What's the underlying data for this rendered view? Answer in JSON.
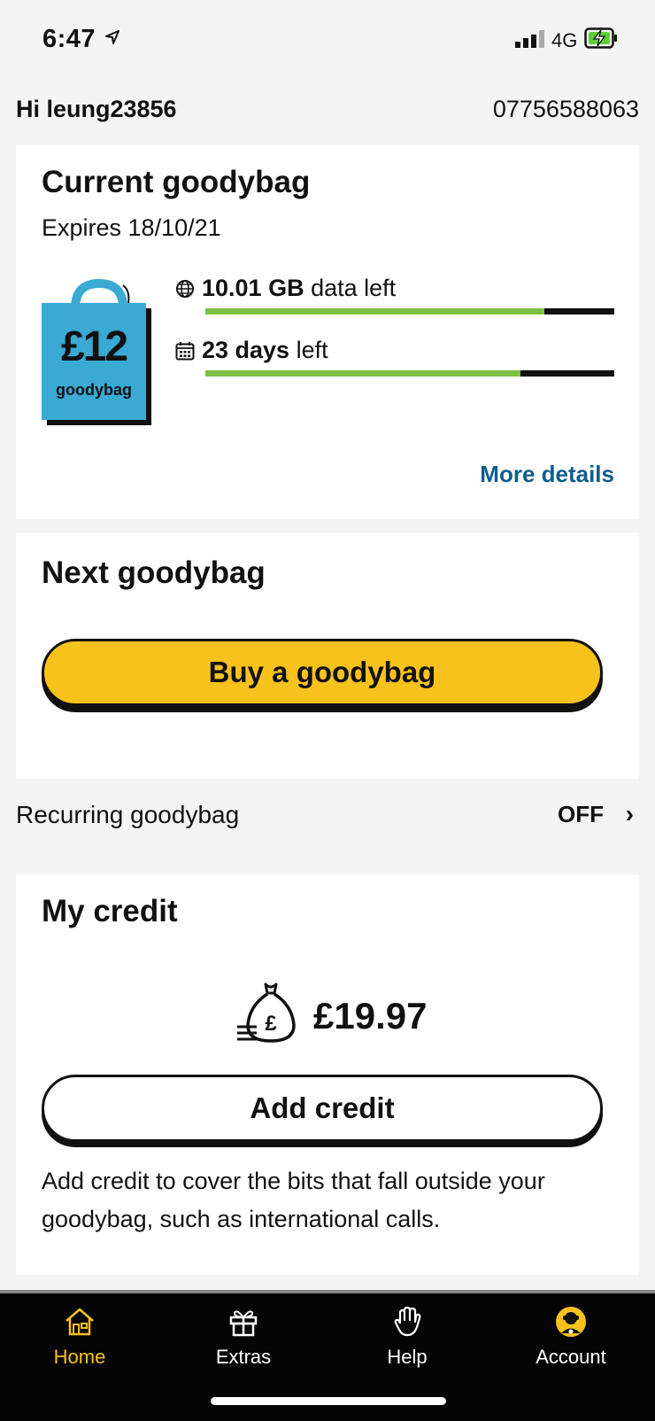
{
  "status_bar": {
    "time": "6:47",
    "network": "4G"
  },
  "header": {
    "greeting": "Hi leung23856",
    "phone_number": "07756588063"
  },
  "current_goodybag": {
    "title": "Current goodybag",
    "expires": "Expires 18/10/21",
    "bag_price": "£12",
    "bag_label": "goodybag",
    "data_value": "10.01 GB",
    "data_suffix": "data left",
    "data_progress_fraction": 0.83,
    "days_value": "23 days",
    "days_suffix": "left",
    "days_progress_fraction": 0.77,
    "more_details": "More details",
    "colors": {
      "bag": "#3aa9d3",
      "progress": "#7bc143",
      "link": "#0d5d8f"
    }
  },
  "next_goodybag": {
    "title": "Next goodybag",
    "buy_button": "Buy a goodybag",
    "button_color": "#f8c21c"
  },
  "recurring": {
    "label": "Recurring goodybag",
    "value": "OFF"
  },
  "credit": {
    "title": "My credit",
    "amount": "£19.97",
    "add_button": "Add credit",
    "description": "Add credit to cover the bits that fall outside your goodybag, such as international calls."
  },
  "tabs": [
    {
      "label": "Home",
      "icon": "home-icon",
      "active": true
    },
    {
      "label": "Extras",
      "icon": "gift-icon",
      "active": false
    },
    {
      "label": "Help",
      "icon": "hand-icon",
      "active": false
    },
    {
      "label": "Account",
      "icon": "avatar-icon",
      "active": false
    }
  ]
}
